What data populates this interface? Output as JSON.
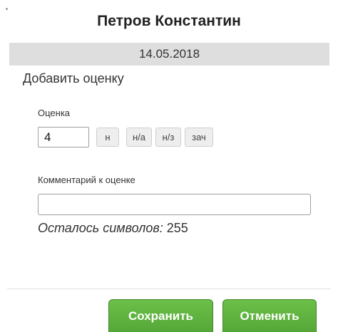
{
  "dialog": {
    "title": "Петров Константин",
    "date": "14.05.2018"
  },
  "form": {
    "heading": "Добавить оценку",
    "grade": {
      "label": "Оценка",
      "value": "4",
      "quick_buttons": [
        "н",
        "н/а",
        "н/з",
        "зач"
      ]
    },
    "comment": {
      "label": "Комментарий к оценке",
      "value": "",
      "chars_left_label": "Осталось символов:",
      "chars_left_value": "255"
    }
  },
  "actions": {
    "save_label": "Сохранить",
    "cancel_label": "Отменить"
  },
  "colors": {
    "accent_green": "#5cb33f",
    "header_bar": "#dedede"
  }
}
